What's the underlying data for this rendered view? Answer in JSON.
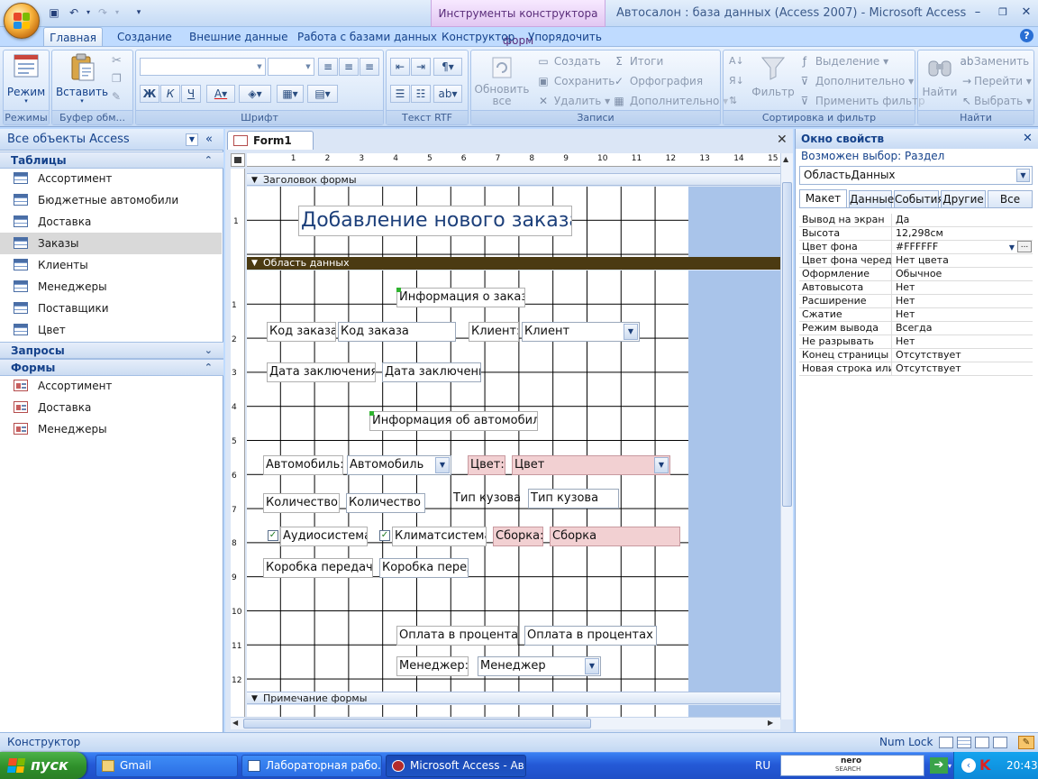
{
  "title_bar": {
    "contextual_tab_title": "Инструменты конструктора форм",
    "window_title": "Автосалон : база данных (Access 2007) - Microsoft Access"
  },
  "ribbon_tabs": [
    "Главная",
    "Создание",
    "Внешние данные",
    "Работа с базами данных",
    "Конструктор",
    "Упорядочить"
  ],
  "ribbon": {
    "groups": {
      "modes": "Режимы",
      "clipboard": "Буфер обм...",
      "font": "Шрифт",
      "rtf": "Текст RTF",
      "records": "Записи",
      "sort_filter": "Сортировка и фильтр",
      "find": "Найти"
    },
    "view_label": "Режим",
    "paste_label": "Вставить",
    "refresh_label_1": "Обновить",
    "refresh_label_2": "все",
    "records": {
      "new": "Создать",
      "save": "Сохранить",
      "delete": "Удалить",
      "totals": "Итоги",
      "spelling": "Орфография",
      "more": "Дополнительно"
    },
    "filter": {
      "filter": "Фильтр",
      "selection": "Выделение",
      "advanced": "Дополнительно",
      "toggle": "Применить фильтр"
    },
    "find": {
      "find": "Найти",
      "replace": "Заменить",
      "goto": "Перейти",
      "select": "Выбрать"
    }
  },
  "nav_pane": {
    "header": "Все объекты Access",
    "sections": [
      {
        "title": "Таблицы",
        "items": [
          "Ассортимент",
          "Бюджетные автомобили",
          "Доставка",
          "Заказы",
          "Клиенты",
          "Менеджеры",
          "Поставщики",
          "Цвет"
        ],
        "selected": "Заказы"
      },
      {
        "title": "Запросы",
        "items": []
      },
      {
        "title": "Формы",
        "items": [
          "Ассортимент",
          "Доставка",
          "Менеджеры"
        ]
      }
    ]
  },
  "document": {
    "tab": "Form1",
    "ruler_top": [
      "1",
      "2",
      "3",
      "4",
      "5",
      "6",
      "7",
      "8",
      "9",
      "10",
      "11",
      "12",
      "13",
      "14",
      "15"
    ],
    "ruler_left_header": [
      "1"
    ],
    "ruler_left_detail": [
      "1",
      "2",
      "3",
      "4",
      "5",
      "6",
      "7",
      "8",
      "9",
      "10",
      "11",
      "12"
    ],
    "sections": {
      "header": "Заголовок формы",
      "detail": "Область данных",
      "footer": "Примечание формы"
    },
    "form_title": "Добавление нового заказа",
    "controls": {
      "order_info": "Информация о заказе",
      "order_code_label": "Код заказа:",
      "order_code": "Код заказа",
      "client_label": "Клиент:",
      "client": "Клиент",
      "date_label": "Дата заключения:",
      "date": "Дата заключения",
      "car_info": "Информация об автомобиле",
      "car_label": "Автомобиль:",
      "car": "Автомобиль",
      "color_label": "Цвет:",
      "color": "Цвет",
      "qty_label": "Количество:",
      "qty": "Количество",
      "body_label": "Тип кузова:",
      "body": "Тип кузова",
      "audio": "Аудиосистема",
      "climate": "Климатсистема",
      "assembly_label": "Сборка:",
      "assembly": "Сборка",
      "gearbox_label": "Коробка передач:",
      "gearbox": "Коробка передач",
      "payment_label": "Оплата в процентах:",
      "payment": "Оплата в процентах",
      "manager_label": "Менеджер:",
      "manager": "Менеджер"
    }
  },
  "property_sheet": {
    "title": "Окно свойств",
    "selection_type": "Возможен выбор:  Раздел",
    "selected_object": "ОбластьДанных",
    "tabs": [
      "Макет",
      "Данные",
      "События",
      "Другие",
      "Все"
    ],
    "active_tab": "Макет",
    "rows": [
      {
        "name": "Вывод на экран",
        "value": "Да"
      },
      {
        "name": "Высота",
        "value": "12,298см"
      },
      {
        "name": "Цвет фона",
        "value": "#FFFFFF"
      },
      {
        "name": "Цвет фона чередо",
        "value": "Нет цвета"
      },
      {
        "name": "Оформление",
        "value": "Обычное"
      },
      {
        "name": "Автовысота",
        "value": "Нет"
      },
      {
        "name": "Расширение",
        "value": "Нет"
      },
      {
        "name": "Сжатие",
        "value": "Нет"
      },
      {
        "name": "Режим вывода",
        "value": "Всегда"
      },
      {
        "name": "Не разрывать",
        "value": "Нет"
      },
      {
        "name": "Конец страницы",
        "value": "Отсутствует"
      },
      {
        "name": "Новая строка или",
        "value": "Отсутствует"
      }
    ]
  },
  "status_bar": {
    "left": "Конструктор",
    "num_lock": "Num Lock"
  },
  "taskbar": {
    "start": "пуск",
    "buttons": [
      "Gmail",
      "Лабораторная рабо...",
      "Microsoft Access - Ав..."
    ],
    "lang": "RU",
    "nero_top": "nero",
    "nero_bottom": "SEARCH",
    "clock": "20:43"
  }
}
